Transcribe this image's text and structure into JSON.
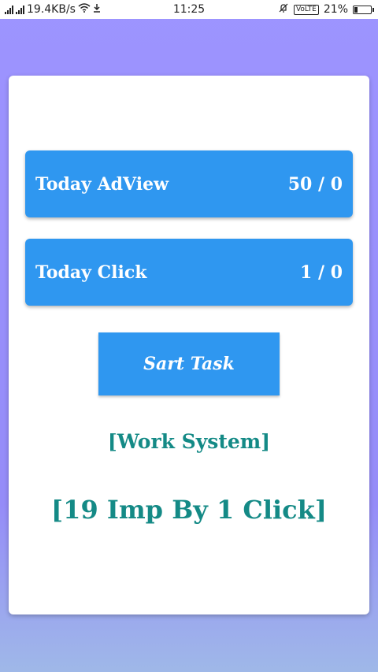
{
  "status_bar": {
    "network_speed": "19.4KB/s",
    "time": "11:25",
    "volte": "VoLTE",
    "battery_text": "21%",
    "battery_level": 0.21
  },
  "stats": [
    {
      "label": "Today AdView",
      "value": "50 / 0"
    },
    {
      "label": "Today Click",
      "value": "1 / 0"
    }
  ],
  "start_button": {
    "label": "Sart Task"
  },
  "info": {
    "work_system": "[Work System]",
    "imp_by_click": "[19 Imp By 1 Click]"
  }
}
